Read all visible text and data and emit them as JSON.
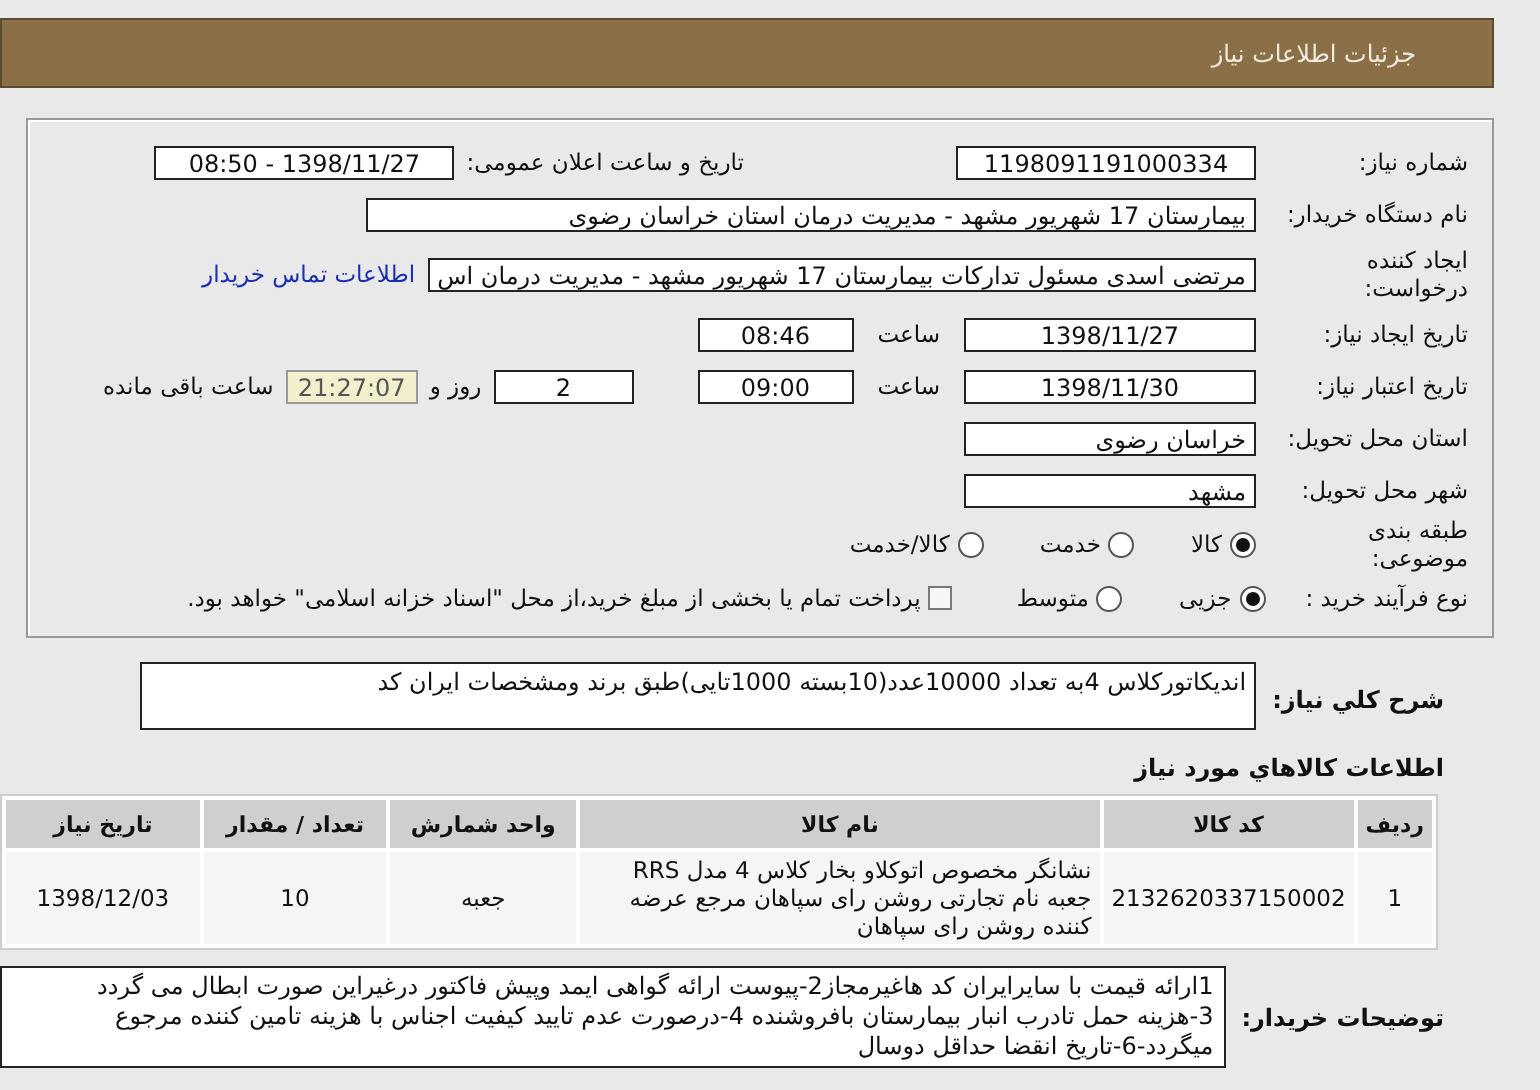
{
  "header": {
    "title": "جزئیات اطلاعات نیاز"
  },
  "need_number": {
    "label": "شماره نیاز:",
    "value": "1198091191000334"
  },
  "announce": {
    "label": "تاریخ و ساعت اعلان عمومی:",
    "value": "1398/11/27 - 08:50"
  },
  "buyer": {
    "label": "نام دستگاه خریدار:",
    "value": "بیمارستان 17 شهریور مشهد - مدیریت درمان استان خراسان رضوی"
  },
  "creator": {
    "label": "ایجاد کننده درخواست:",
    "value": "مرتضی اسدی مسئول تدارکات بیمارستان 17 شهریور مشهد - مدیریت درمان اس",
    "link": "اطلاعات تماس خریدار"
  },
  "created": {
    "label": "تاریخ ایجاد نیاز:",
    "date": "1398/11/27",
    "time_label": "ساعت",
    "time": "08:46"
  },
  "valid_until": {
    "label": "تاریخ اعتبار نیاز:",
    "date": "1398/11/30",
    "time_label": "ساعت",
    "time": "09:00",
    "days": "2",
    "days_label": "روز و",
    "remaining": "21:27:07",
    "remaining_label": "ساعت باقی مانده"
  },
  "province": {
    "label": "استان محل تحویل:",
    "value": "خراسان رضوی"
  },
  "city": {
    "label": "شهر محل تحویل:",
    "value": "مشهد"
  },
  "category": {
    "label": "طبقه بندی موضوعی:",
    "options": [
      {
        "label": "کالا",
        "selected": true
      },
      {
        "label": "خدمت",
        "selected": false
      },
      {
        "label": "کالا/خدمت",
        "selected": false
      }
    ]
  },
  "process": {
    "label": "نوع فرآیند خرید :",
    "options": [
      {
        "label": "جزیی",
        "selected": true
      },
      {
        "label": "متوسط",
        "selected": false
      }
    ],
    "treasury": {
      "checked": false,
      "text": "پرداخت تمام یا بخشی از مبلغ خرید،از محل \"اسناد خزانه اسلامی\" خواهد بود."
    }
  },
  "description": {
    "label": "شرح کلي نياز:",
    "value": "اندیکاتورکلاس 4به تعداد 10000عدد(10بسته 1000تایی)طبق برند ومشخصات ایران کد"
  },
  "goods": {
    "title": "اطلاعات کالاهاي مورد نياز",
    "columns": [
      "ردیف",
      "کد کالا",
      "نام کالا",
      "واحد شمارش",
      "تعداد / مقدار",
      "تاریخ نیاز"
    ],
    "rows": [
      [
        "1",
        "2132620337150002",
        "نشانگر مخصوص اتوکلاو بخار کلاس 4 مدل RRS جعبه نام تجارتی روشن رای سپاهان مرجع عرضه کننده روشن رای سپاهان",
        "جعبه",
        "10",
        "1398/12/03"
      ]
    ]
  },
  "notes": {
    "label": "توضیحات خریدار:",
    "lines": [
      "1ارائه قیمت با سایرایران کد هاغیرمجاز2-پیوست ارائه گواهی ایمد وپیش فاکتور  درغیراین صورت ابطال می گردد",
      "3-هزینه حمل تادرب انبار بیمارستان بافروشنده 4-درصورت عدم تایید کیفیت  اجناس با هزینه تامین کننده مرجوع میگردد-6-تاریخ انقضا حداقل دوسال"
    ]
  }
}
